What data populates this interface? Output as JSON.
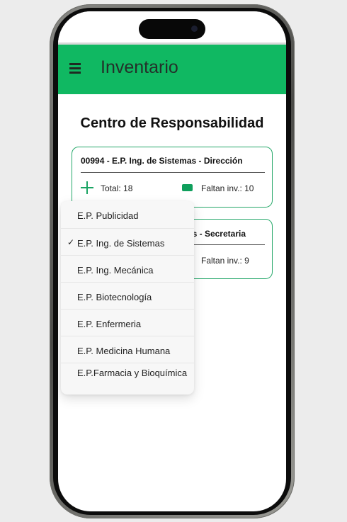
{
  "app": {
    "title": "Inventario",
    "menu_icon": "hamburger-menu-icon",
    "accent": "#10b862"
  },
  "page": {
    "heading": "Centro de Responsabilidad"
  },
  "cards": [
    {
      "title": "00994 - E.P. Ing. de Sistemas - Dirección",
      "total": "Total: 18",
      "faltan": "Faltan inv.: 10"
    },
    {
      "title": "s - Secretaria",
      "faltan": "Faltan inv.: 9"
    }
  ],
  "dropdown": {
    "options": [
      {
        "label": "E.P. Publicidad",
        "selected": false
      },
      {
        "label": "E.P. Ing. de Sistemas",
        "selected": true
      },
      {
        "label": "E.P. Ing. Mecánica",
        "selected": false
      },
      {
        "label": "E.P. Biotecnología",
        "selected": false
      },
      {
        "label": "E.P. Enfermeria",
        "selected": false
      },
      {
        "label": "E.P. Medicina Humana",
        "selected": false
      },
      {
        "label": "E.P.Farmacia y Bioquímica",
        "selected": false
      }
    ],
    "check_mark": "✓"
  }
}
